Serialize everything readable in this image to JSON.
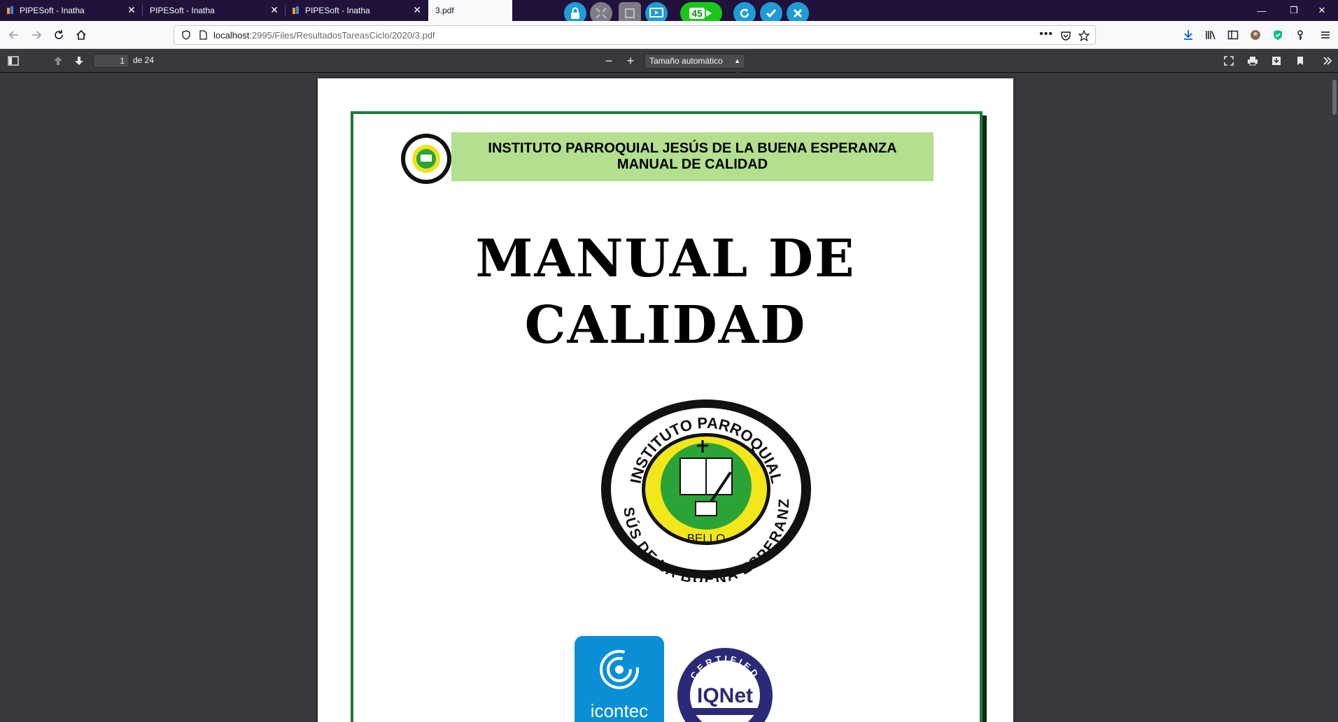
{
  "tabs": [
    {
      "title": "PIPESoft - Inatha",
      "favicon": true
    },
    {
      "title": "PIPESoft - Inatha",
      "favicon": false
    },
    {
      "title": "PIPESoft - Inatha",
      "favicon": true
    },
    {
      "title": "3.pdf",
      "favicon": false,
      "active": true
    }
  ],
  "tab_close_glyph": "✕",
  "overlay": {
    "counter": "45",
    "icons": [
      "lock-icon",
      "collapse-icon",
      "expand-icon",
      "present-icon",
      "record-icon",
      "refresh-icon",
      "check-icon",
      "close-icon"
    ]
  },
  "window_controls": {
    "minimize": "—",
    "restore": "❐",
    "close": "✕"
  },
  "url": {
    "host": "localhost",
    "path": ":2995/Files/ResultadosTareasCiclo/2020/3.pdf"
  },
  "pdf_toolbar": {
    "page_number": "1",
    "page_count": "de 24",
    "zoom_label": "Tamaño automático",
    "zoom_out": "−",
    "zoom_in": "+"
  },
  "document": {
    "header_line1": "INSTITUTO PARROQUIAL JESÚS DE LA BUENA ESPERANZA",
    "header_line2": "MANUAL DE CALIDAD",
    "title_line1": "MANUAL DE",
    "title_line2": "CALIDAD",
    "seal_top_text": "INSTITUTO PARROQUIAL",
    "seal_bottom_text": "JESÚS DE LA BUENA ESPERANZA",
    "seal_city": "BELLO",
    "cert1_label": "icontec",
    "cert2_label": "IQNet",
    "cert2_ring": "CERTIFIED"
  },
  "colors": {
    "tabbar": "#20123a",
    "header_band": "#b3df8e",
    "frame_green": "#1f7a3c",
    "overlay_blue": "#1f9bd6",
    "record_green": "#19c719",
    "icontec_blue": "#0a8fd6",
    "iqnet_navy": "#2b2a78"
  }
}
